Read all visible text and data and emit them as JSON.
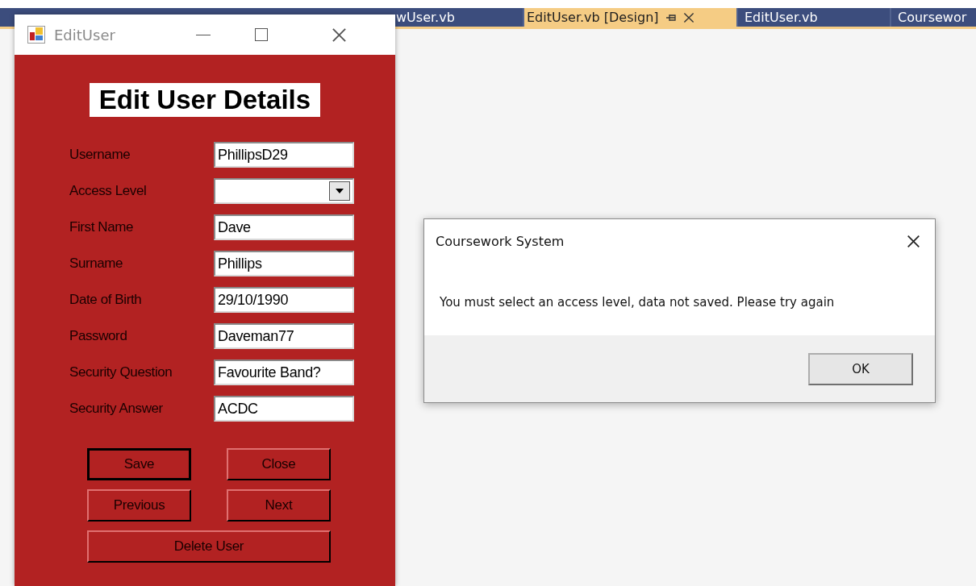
{
  "ide": {
    "tabs": [
      {
        "label": "wUser.vb",
        "selected": false
      },
      {
        "label": "EditUser.vb [Design]",
        "selected": true
      },
      {
        "label": "EditUser.vb",
        "selected": false
      },
      {
        "label": "Coursewor",
        "selected": false
      }
    ]
  },
  "form_window": {
    "title": "EditUser",
    "heading": "Edit User Details",
    "fields": [
      {
        "label": "Username",
        "kind": "text",
        "value": "PhillipsD29"
      },
      {
        "label": "Access Level",
        "kind": "dropdown"
      },
      {
        "label": "First Name",
        "kind": "text",
        "value": "Dave"
      },
      {
        "label": "Surname",
        "kind": "text",
        "value": "Phillips"
      },
      {
        "label": "Date of Birth",
        "kind": "text",
        "value": "29/10/1990"
      },
      {
        "label": "Password",
        "kind": "text",
        "value": "Daveman77"
      },
      {
        "label": "Security Question",
        "kind": "text",
        "value": "Favourite Band?"
      },
      {
        "label": "Security Answer",
        "kind": "text",
        "value": "ACDC"
      }
    ],
    "buttons": [
      {
        "label": "Save",
        "default": true
      },
      {
        "label": "Close",
        "default": false
      },
      {
        "label": "Previous",
        "default": false
      },
      {
        "label": "Next",
        "default": false
      },
      {
        "label": "Delete User",
        "default": false
      }
    ]
  },
  "dialog": {
    "title": "Coursework System",
    "message": "You must select an access level, data not saved. Please try again",
    "buttons": [
      "OK"
    ]
  }
}
